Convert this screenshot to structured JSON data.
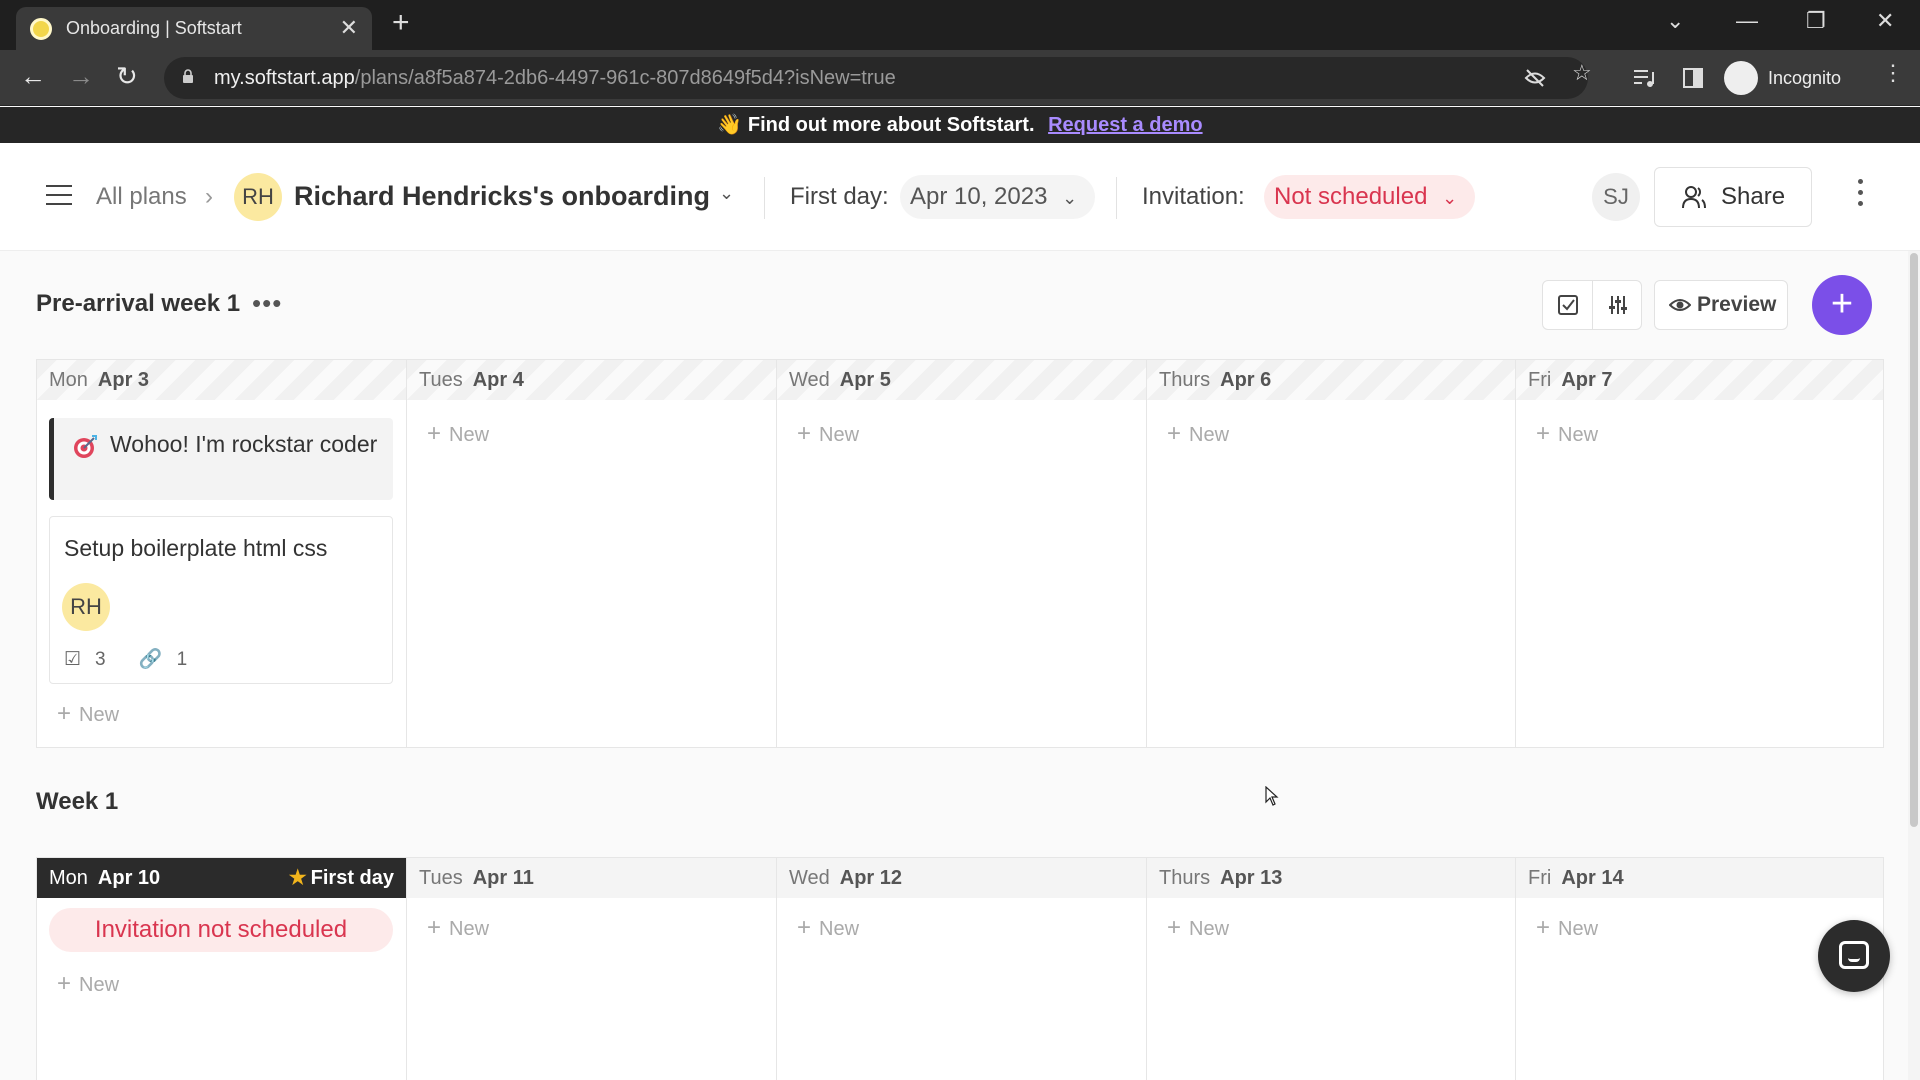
{
  "browser": {
    "tab_title": "Onboarding | Softstart",
    "close_glyph": "✕",
    "new_tab_glyph": "+",
    "url_host": "my.softstart.app",
    "url_path": "/plans/a8f5a874-2db6-4497-961c-807d8649f5d4?isNew=true",
    "incognito_label": "Incognito",
    "back_glyph": "←",
    "forward_glyph": "→",
    "reload_glyph": "↻",
    "minimize_glyph": "—",
    "restore_glyph": "❐",
    "window_close_glyph": "✕",
    "tab_search_glyph": "⌄",
    "star_glyph": "☆",
    "menu_glyph": "⋮"
  },
  "banner": {
    "emoji": "👋",
    "text": "Find out more about Softstart.",
    "link": "Request a demo"
  },
  "header": {
    "breadcrumb_all": "All plans",
    "breadcrumb_sep": "›",
    "avatar_initials": "RH",
    "plan_title": "Richard Hendricks's onboarding",
    "chevron": "⌄",
    "first_day_label": "First day:",
    "first_day_value": "Apr 10, 2023",
    "invitation_label": "Invitation:",
    "invitation_value": "Not scheduled",
    "user_initials": "SJ",
    "share_label": "Share"
  },
  "toolbar": {
    "preview_label": "Preview",
    "add_glyph": "+"
  },
  "new_label": "New",
  "plus_glyph": "+",
  "sections": [
    {
      "title": "Pre-arrival week 1",
      "more_glyph": "•••",
      "days": [
        {
          "dow": "Mon",
          "date": "Apr 3"
        },
        {
          "dow": "Tues",
          "date": "Apr 4"
        },
        {
          "dow": "Wed",
          "date": "Apr 5"
        },
        {
          "dow": "Thurs",
          "date": "Apr 6"
        },
        {
          "dow": "Fri",
          "date": "Apr 7"
        }
      ],
      "milestone": {
        "text": "Wohoo! I'm rockstar coder"
      },
      "task": {
        "title": "Setup boilerplate html css",
        "assignee": "RH",
        "checklist_count": "3",
        "link_count": "1"
      }
    },
    {
      "title": "Week 1",
      "days": [
        {
          "dow": "Mon",
          "date": "Apr 10"
        },
        {
          "dow": "Tues",
          "date": "Apr 11"
        },
        {
          "dow": "Wed",
          "date": "Apr 12"
        },
        {
          "dow": "Thurs",
          "date": "Apr 13"
        },
        {
          "dow": "Fri",
          "date": "Apr 14"
        }
      ],
      "first_day_tag": "First day",
      "star_glyph": "★",
      "invitation_pill": "Invitation not scheduled"
    }
  ],
  "colors": {
    "accent": "#7b4fe8",
    "danger": "#d9354f",
    "avatar_bg": "#fbe9a0"
  }
}
